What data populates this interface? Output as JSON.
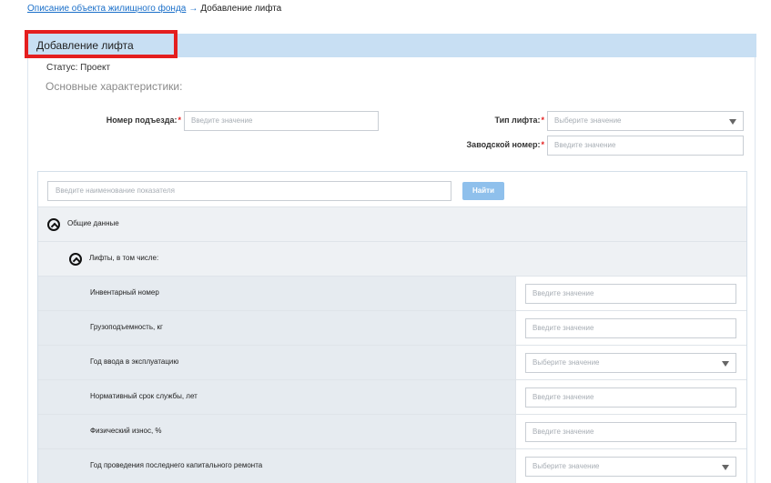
{
  "breadcrumb": {
    "link": "Описание объекта жилищного фонда",
    "separator": "→",
    "current": "Добавление лифта"
  },
  "panel": {
    "title": "Добавление лифта",
    "status": "Статус: Проект",
    "section_title": "Основные характеристики:"
  },
  "form": {
    "entrance_label": "Номер подъезда:",
    "entrance_placeholder": "Введите значение",
    "lift_type_label": "Тип лифта:",
    "lift_type_placeholder": "Выберите значение",
    "serial_label": "Заводской номер:",
    "serial_placeholder": "Введите значение",
    "required_mark": "*"
  },
  "search": {
    "placeholder": "Введите наименование показателя",
    "button": "Найти"
  },
  "groups": {
    "general": "Общие данные",
    "lifts": "Лифты, в том числе:"
  },
  "rows": [
    {
      "label": "Инвентарный номер",
      "placeholder": "Введите значение",
      "kind": "input"
    },
    {
      "label": "Грузоподъемность, кг",
      "placeholder": "Введите значение",
      "kind": "input"
    },
    {
      "label": "Год ввода в эксплуатацию",
      "placeholder": "Выберите значение",
      "kind": "select"
    },
    {
      "label": "Нормативный срок службы, лет",
      "placeholder": "Введите значение",
      "kind": "input"
    },
    {
      "label": "Физический износ, %",
      "placeholder": "Введите значение",
      "kind": "input"
    },
    {
      "label": "Год проведения последнего капитального ремонта",
      "placeholder": "Выберите значение",
      "kind": "select"
    }
  ],
  "icons": {
    "collapse": "chevron-up-circle-icon",
    "dropdown": "caret-down-icon"
  },
  "colors": {
    "header_bg": "#c8dff3",
    "highlight": "#e41e1e",
    "link": "#1a6fc9",
    "button": "#8fc0ec"
  }
}
